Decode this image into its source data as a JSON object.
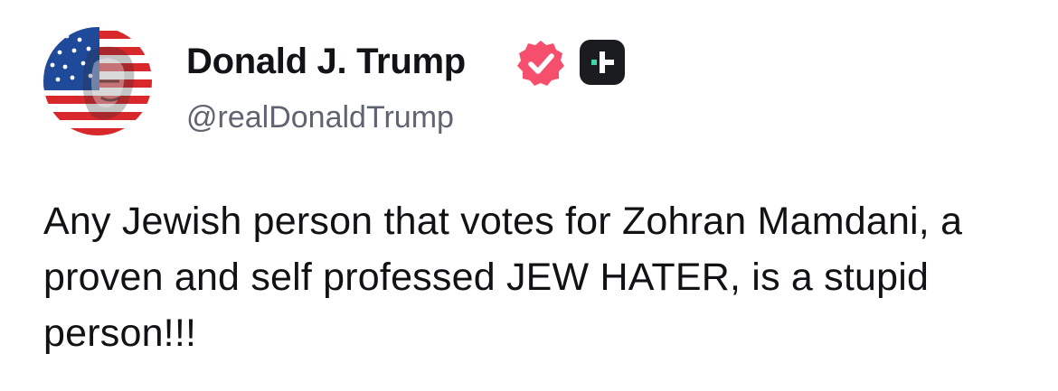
{
  "author": {
    "display_name": "Donald J. Trump",
    "handle": "@realDonaldTrump",
    "verified": true,
    "verified_badge_icon": "verified-check-icon",
    "verified_color": "#f64f6d",
    "platform_badge_icon": "plus-badge-icon",
    "platform_badge_color": "#1b1c20",
    "platform_accent_color": "#3fd6a3"
  },
  "post": {
    "text": "Any Jewish person that votes for Zohran Mamdani, a proven and self professed JEW HATER, is a stupid person!!!"
  }
}
